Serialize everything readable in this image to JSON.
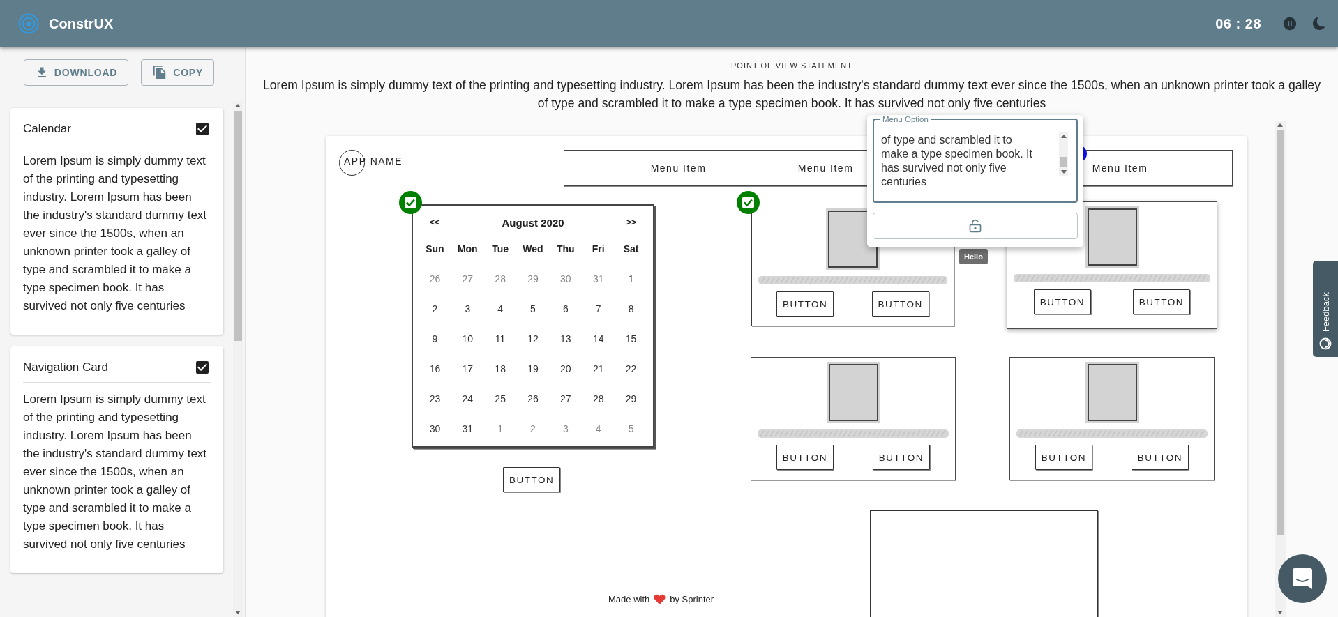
{
  "header": {
    "app_name": "ConstrUX",
    "timer": "06 : 28"
  },
  "sidebar": {
    "buttons": [
      {
        "label": "DOWNLOAD",
        "kind": "download"
      },
      {
        "label": "COPY",
        "kind": "copy"
      }
    ],
    "cards": [
      {
        "title": "Calendar",
        "checked": true,
        "text": "Lorem Ipsum is simply dummy text of the printing and typesetting industry. Lorem Ipsum has been the industry's standard dummy text ever since the 1500s, when an unknown printer took a galley of type and scrambled it to make a type specimen book. It has survived not only five centuries"
      },
      {
        "title": "Navigation Card",
        "checked": true,
        "text": "Lorem Ipsum is simply dummy text of the printing and typesetting industry. Lorem Ipsum has been the industry's standard dummy text ever since the 1500s, when an unknown printer took a galley of type and scrambled it to make a type specimen book. It has survived not only five centuries"
      }
    ]
  },
  "statement": {
    "heading": "POINT OF VIEW STATEMENT",
    "text": "Lorem Ipsum is simply dummy text of the printing and typesetting industry. Lorem Ipsum has been the industry's standard dummy text ever since the 1500s, when an unknown printer took a galley of type and scrambled it to make a type specimen book. It has survived not only five centuries"
  },
  "canvas": {
    "app_name": "APP NAME",
    "menu_items": [
      "Menu Item",
      "Menu Item",
      "Menu Item"
    ],
    "calendar": {
      "checked": true,
      "prev": "<<",
      "title": "August 2020",
      "next": ">>",
      "weekdays": [
        "Sun",
        "Mon",
        "Tue",
        "Wed",
        "Thu",
        "Fri",
        "Sat"
      ],
      "weeks": [
        [
          {
            "label": "26",
            "outside": true
          },
          {
            "label": "27",
            "outside": true
          },
          {
            "label": "28",
            "outside": true
          },
          {
            "label": "29",
            "outside": true
          },
          {
            "label": "30",
            "outside": true
          },
          {
            "label": "31",
            "outside": true
          },
          {
            "label": "1",
            "outside": false
          }
        ],
        [
          {
            "label": "2",
            "outside": false
          },
          {
            "label": "3",
            "outside": false
          },
          {
            "label": "4",
            "outside": false
          },
          {
            "label": "5",
            "outside": false
          },
          {
            "label": "6",
            "outside": false
          },
          {
            "label": "7",
            "outside": false
          },
          {
            "label": "8",
            "outside": false
          }
        ],
        [
          {
            "label": "9",
            "outside": false
          },
          {
            "label": "10",
            "outside": false
          },
          {
            "label": "11",
            "outside": false
          },
          {
            "label": "12",
            "outside": false
          },
          {
            "label": "13",
            "outside": false
          },
          {
            "label": "14",
            "outside": false
          },
          {
            "label": "15",
            "outside": false
          }
        ],
        [
          {
            "label": "16",
            "outside": false
          },
          {
            "label": "17",
            "outside": false
          },
          {
            "label": "18",
            "outside": false
          },
          {
            "label": "19",
            "outside": false
          },
          {
            "label": "20",
            "outside": false
          },
          {
            "label": "21",
            "outside": false
          },
          {
            "label": "22",
            "outside": false
          }
        ],
        [
          {
            "label": "23",
            "outside": false
          },
          {
            "label": "24",
            "outside": false
          },
          {
            "label": "25",
            "outside": false
          },
          {
            "label": "26",
            "outside": false
          },
          {
            "label": "27",
            "outside": false
          },
          {
            "label": "28",
            "outside": false
          },
          {
            "label": "29",
            "outside": false
          }
        ],
        [
          {
            "label": "30",
            "outside": false
          },
          {
            "label": "31",
            "outside": false
          },
          {
            "label": "1",
            "outside": true
          },
          {
            "label": "2",
            "outside": true
          },
          {
            "label": "3",
            "outside": true
          },
          {
            "label": "4",
            "outside": true
          },
          {
            "label": "5",
            "outside": true
          }
        ]
      ],
      "button": "BUTTON"
    },
    "cards": [
      {
        "checked": true,
        "raised": false,
        "buttons": [
          "BUTTON",
          "BUTTON"
        ]
      },
      {
        "checked": false,
        "raised": true,
        "buttons": [
          "BUTTON",
          "BUTTON"
        ]
      },
      {
        "checked": false,
        "raised": false,
        "buttons": [
          "BUTTON",
          "BUTTON"
        ]
      },
      {
        "checked": false,
        "raised": false,
        "buttons": [
          "BUTTON",
          "BUTTON"
        ]
      }
    ],
    "footer": {
      "before": "Made with",
      "after": "by Sprinter"
    }
  },
  "popup": {
    "legend": "Menu Option",
    "value": "of type and scrambled it to make a type specimen book. It has survived not only five centuries",
    "locked": false
  },
  "tooltip": "Hello",
  "feedback": {
    "label": "Feedback"
  }
}
